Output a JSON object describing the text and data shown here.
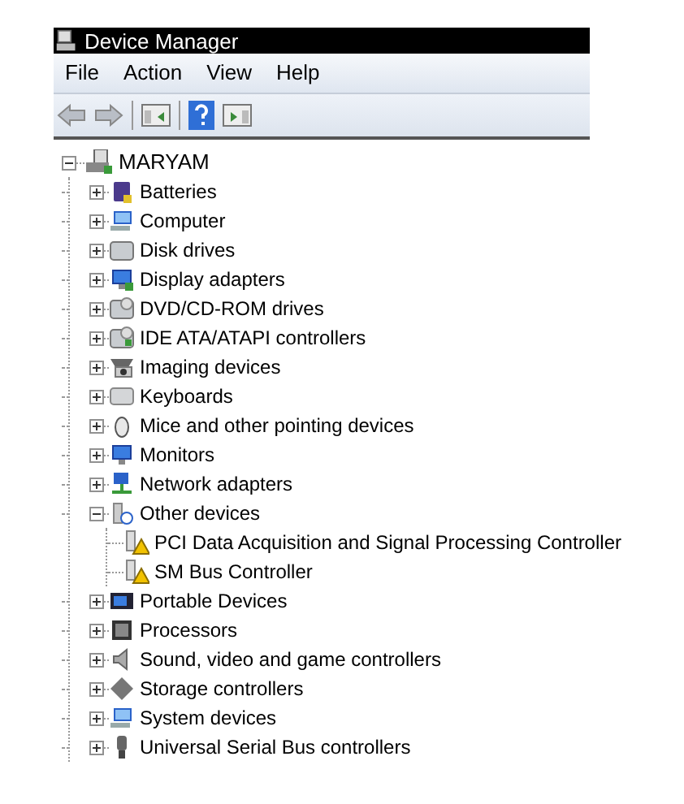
{
  "window": {
    "title": "Device Manager"
  },
  "menu": [
    "File",
    "Action",
    "View",
    "Help"
  ],
  "tree": {
    "label": "MARYAM",
    "expanded": true,
    "children": [
      {
        "label": "Batteries",
        "expanded": false
      },
      {
        "label": "Computer",
        "expanded": false
      },
      {
        "label": "Disk drives",
        "expanded": false
      },
      {
        "label": "Display adapters",
        "expanded": false
      },
      {
        "label": "DVD/CD-ROM drives",
        "expanded": false
      },
      {
        "label": "IDE ATA/ATAPI controllers",
        "expanded": false
      },
      {
        "label": "Imaging devices",
        "expanded": false
      },
      {
        "label": "Keyboards",
        "expanded": false
      },
      {
        "label": "Mice and other pointing devices",
        "expanded": false
      },
      {
        "label": "Monitors",
        "expanded": false
      },
      {
        "label": "Network adapters",
        "expanded": false
      },
      {
        "label": "Other devices",
        "expanded": true,
        "children": [
          {
            "label": "PCI Data Acquisition and Signal Processing Controller",
            "warning": true
          },
          {
            "label": "SM Bus Controller",
            "warning": true
          }
        ]
      },
      {
        "label": "Portable Devices",
        "expanded": false
      },
      {
        "label": "Processors",
        "expanded": false
      },
      {
        "label": "Sound, video and game controllers",
        "expanded": false
      },
      {
        "label": "Storage controllers",
        "expanded": false
      },
      {
        "label": "System devices",
        "expanded": false
      },
      {
        "label": "Universal Serial Bus controllers",
        "expanded": false
      }
    ]
  }
}
